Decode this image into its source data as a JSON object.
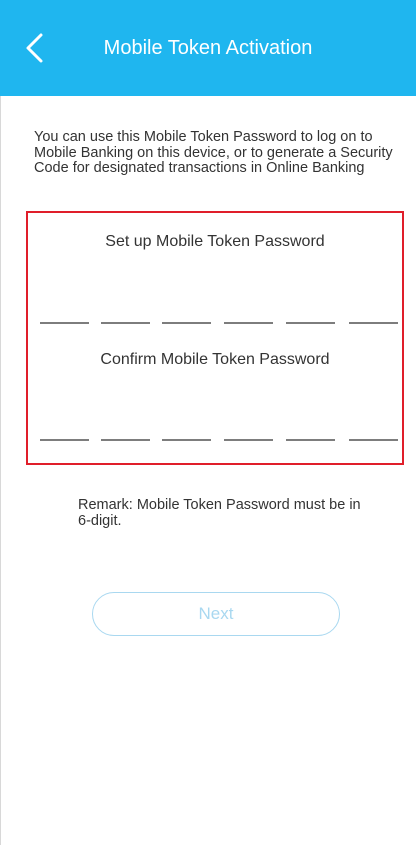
{
  "header": {
    "title": "Mobile Token Activation",
    "back_icon": "chevron-left-icon",
    "background_color": "#1fb6ef"
  },
  "description": "You can use this Mobile Token Password to log on to Mobile Banking on this device, or to generate a Security Code for designated transactions in Online Banking",
  "password_panel": {
    "highlight_color": "#e01e2a",
    "setup_label": "Set up Mobile Token Password",
    "confirm_label": "Confirm Mobile Token Password",
    "digits_per_field": 6,
    "setup_value": "",
    "confirm_value": ""
  },
  "remark": "Remark: Mobile Token Password must be in 6-digit.",
  "next_button": {
    "label": "Next",
    "enabled": false,
    "color": "#a9d8f0"
  }
}
